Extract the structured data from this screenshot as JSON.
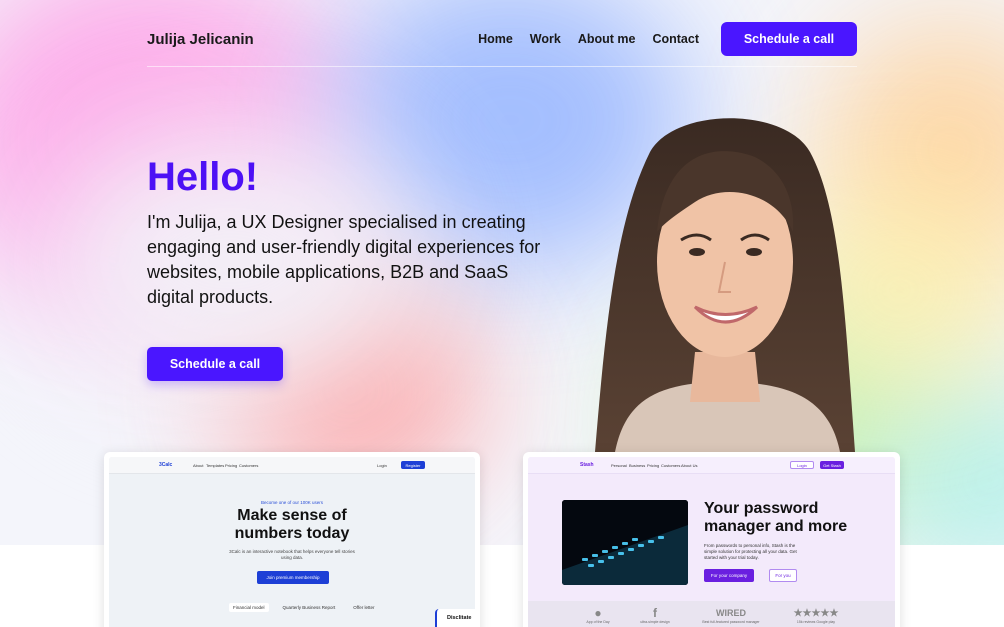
{
  "header": {
    "brand": "Julija Jelicanin",
    "nav": [
      "Home",
      "Work",
      "About me",
      "Contact"
    ],
    "cta": "Schedule a call"
  },
  "hero": {
    "greeting": "Hello!",
    "intro": "I'm Julija, a UX Designer specialised in creating engaging and user-friendly digital experiences for websites, mobile applications, B2B and SaaS digital products.",
    "cta": "Schedule a call"
  },
  "projects": [
    {
      "logo": "3Calc",
      "nav": [
        "About",
        "Templates",
        "Pricing",
        "Customers"
      ],
      "login": "Login",
      "register": "Register",
      "eyebrow": "Become one of our 100K users",
      "title_line1": "Make sense of",
      "title_line2": "numbers today",
      "subtitle": "3Calc is an interactive notebook that helps everyone tell stories using data.",
      "button": "Join premium membership",
      "tabs": [
        "Financial model",
        "Quarterly Business Report",
        "Offer letter"
      ],
      "side_label": "Disclitate"
    },
    {
      "logo": "Stash",
      "nav": [
        "Personal",
        "Business",
        "Pricing",
        "Customers",
        "About Us"
      ],
      "login": "Login",
      "register": "Get Stash",
      "title_line1": "Your password",
      "title_line2": "manager and more",
      "subtitle": "From passwords to personal info, Stash is the simple solution for protecting all your data. Get started with your trial today.",
      "button_primary": "For your company",
      "button_secondary": "For you",
      "logos": [
        {
          "mark": "",
          "caption": "App of the Day"
        },
        {
          "mark": "f",
          "caption": "ultra-simple design"
        },
        {
          "mark": "WIRED",
          "caption": "Best full-featured password manager"
        },
        {
          "mark": "★★★★★",
          "caption": "15k reviews    Google play"
        }
      ]
    }
  ],
  "colors": {
    "accent": "#4a16ff",
    "greeting": "#4d10f5"
  }
}
